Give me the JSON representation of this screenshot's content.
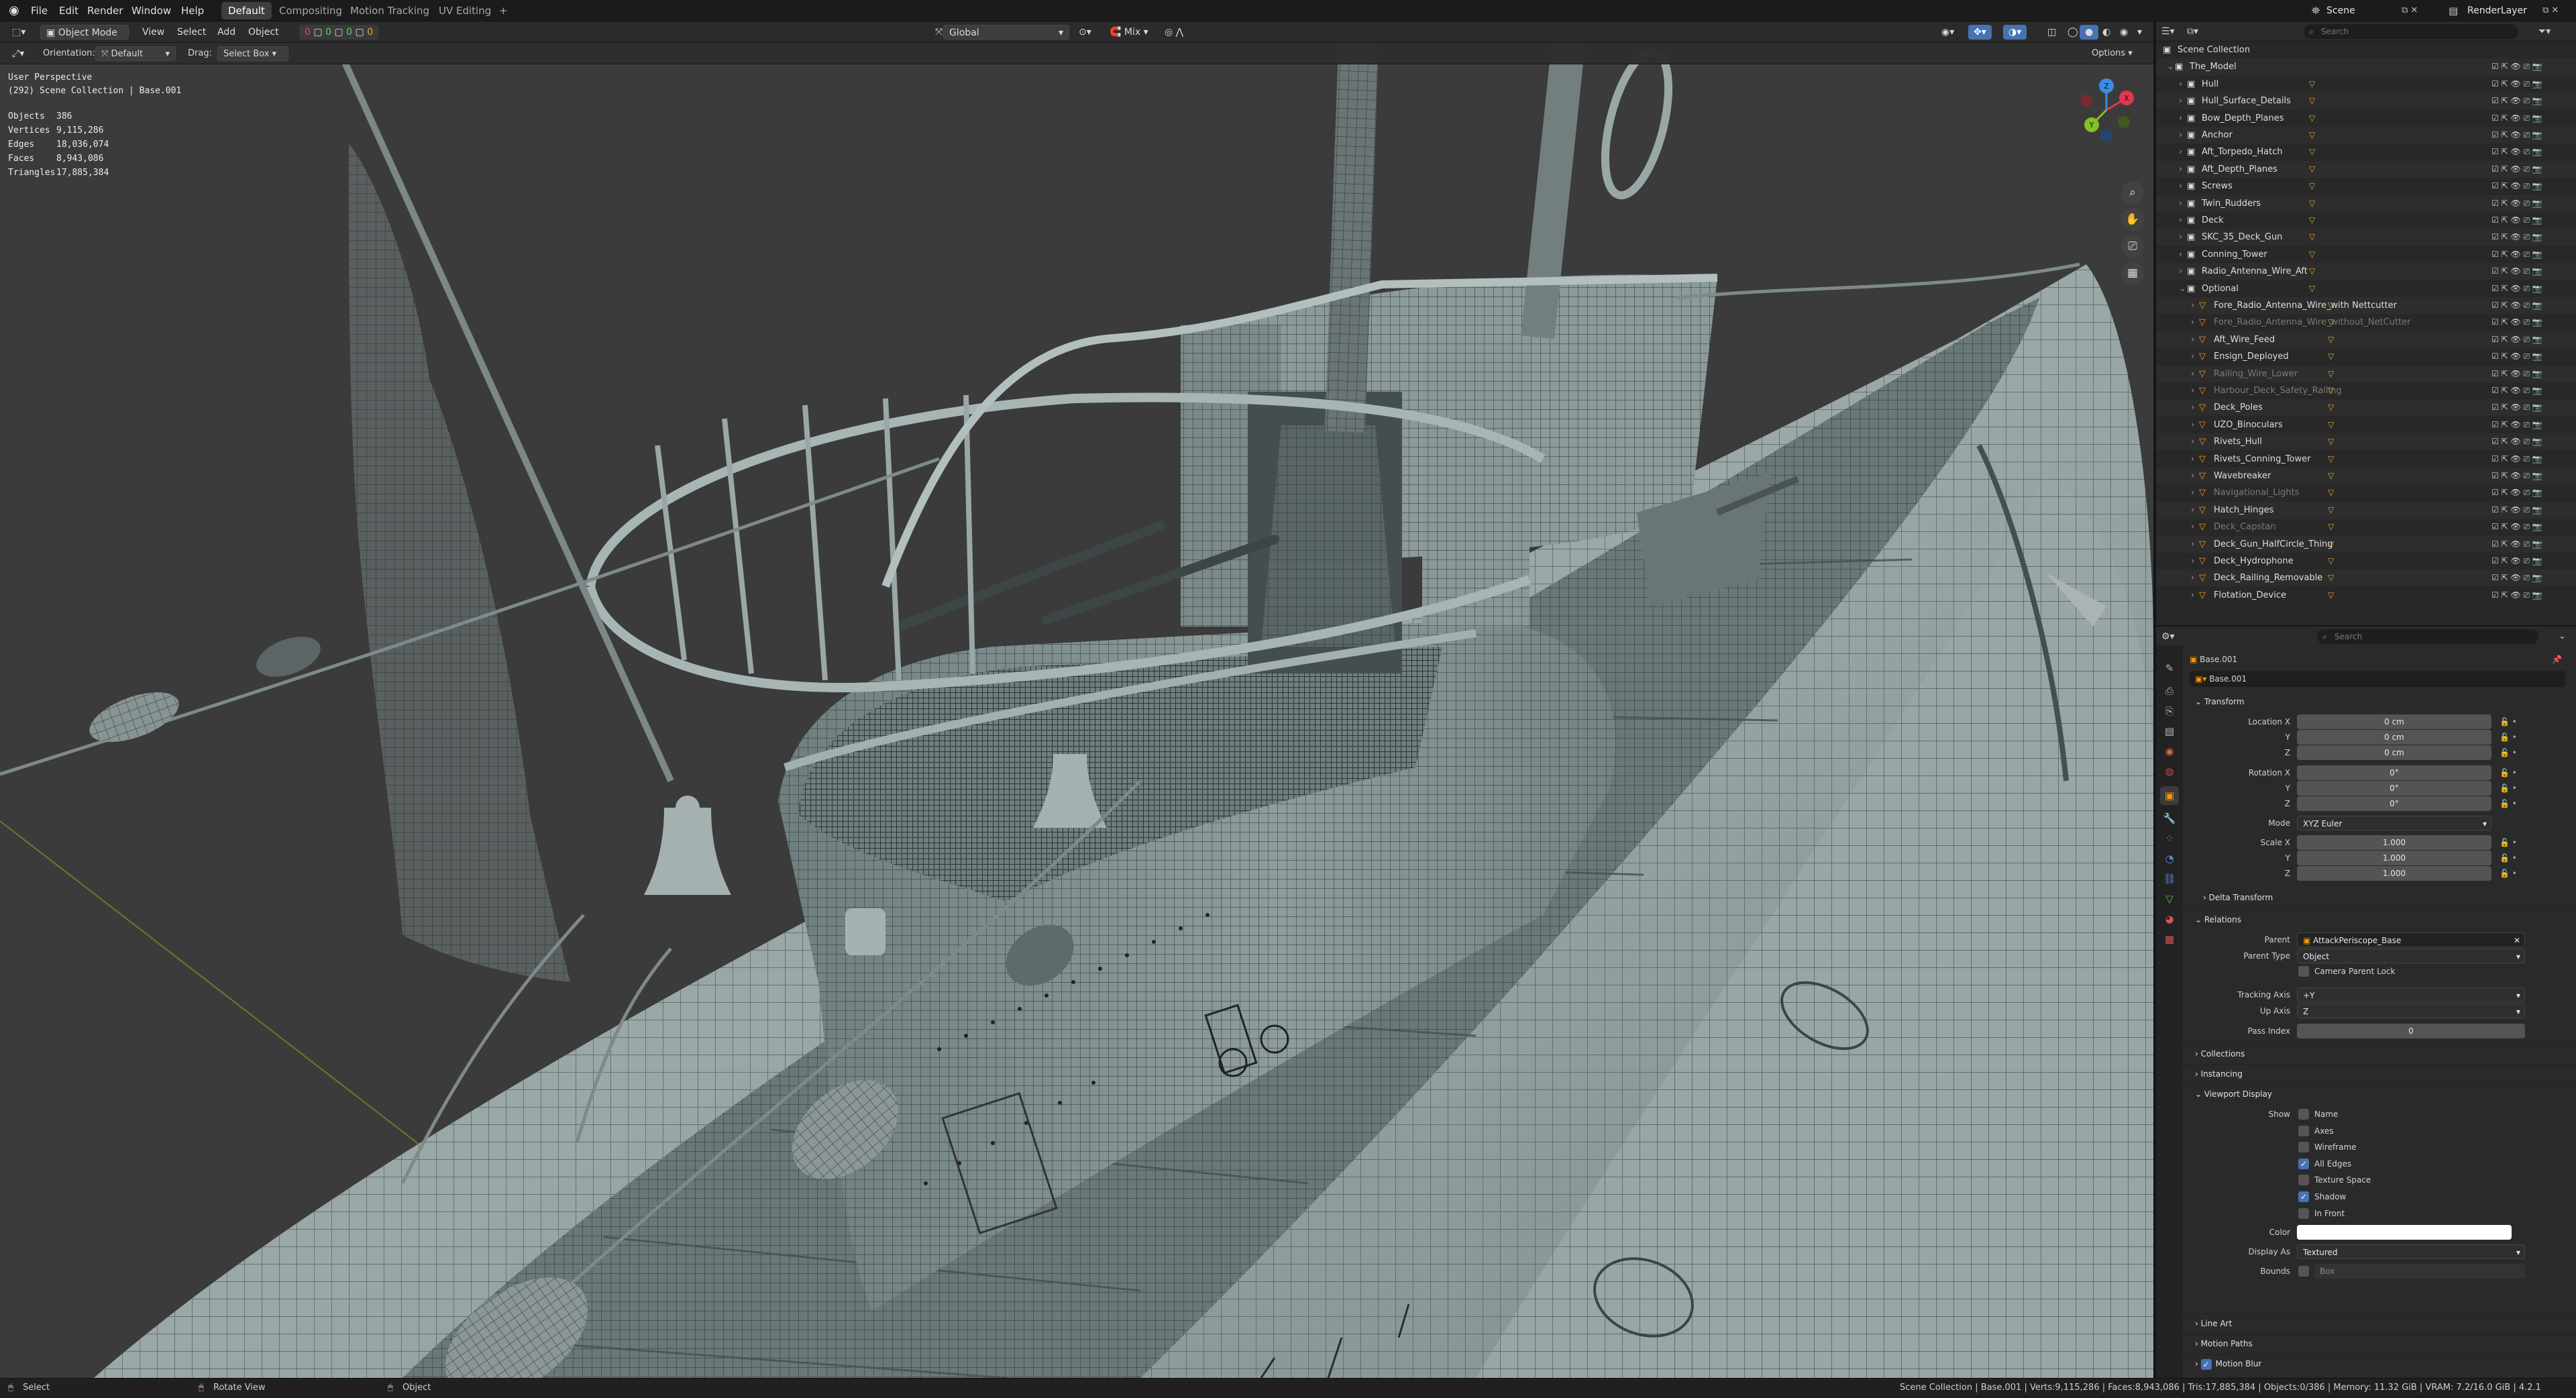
{
  "menubar": {
    "menus": [
      "File",
      "Edit",
      "Render",
      "Window",
      "Help"
    ],
    "workspaces": [
      "Default",
      "Compositing",
      "Motion Tracking",
      "UV Editing"
    ],
    "active_workspace": "Default",
    "add_tab": "+",
    "scene": "Scene",
    "render_layer": "RenderLayer"
  },
  "viewport_header": {
    "mode": "Object Mode",
    "menus": [
      "View",
      "Select",
      "Add",
      "Object"
    ],
    "transform_orientation": "Global",
    "pivot_label": "Mix",
    "orientation_label": "Orientation:",
    "orientation_value": "Default",
    "drag_label": "Drag:",
    "drag_value": "Select Box",
    "options": "Options",
    "visibility_counts": [
      "0",
      "0",
      "0",
      "0"
    ]
  },
  "overlay": {
    "view_name": "User Perspective",
    "collection_path": "(292) Scene Collection | Base.001",
    "stats": [
      {
        "label": "Objects",
        "value": "386"
      },
      {
        "label": "Vertices",
        "value": "9,115,286"
      },
      {
        "label": "Edges",
        "value": "18,036,074"
      },
      {
        "label": "Faces",
        "value": "8,943,086"
      },
      {
        "label": "Triangles",
        "value": "17,885,384"
      }
    ],
    "axes": {
      "x": "X",
      "y": "Y",
      "z": "Z"
    },
    "colors": {
      "x": "#e4374e",
      "y": "#83c225",
      "z": "#3b8de3"
    }
  },
  "outliner": {
    "search_placeholder": "Search",
    "root": "Scene Collection",
    "collection": "The_Model",
    "items": [
      {
        "label": "Hull",
        "depth": 1,
        "dim": false
      },
      {
        "label": "Hull_Surface_Details",
        "depth": 1,
        "dim": false
      },
      {
        "label": "Bow_Depth_Planes",
        "depth": 1,
        "dim": false
      },
      {
        "label": "Anchor",
        "depth": 1,
        "dim": false
      },
      {
        "label": "Aft_Torpedo_Hatch",
        "depth": 1,
        "dim": false
      },
      {
        "label": "Aft_Depth_Planes",
        "depth": 1,
        "dim": false
      },
      {
        "label": "Screws",
        "depth": 1,
        "dim": false
      },
      {
        "label": "Twin_Rudders",
        "depth": 1,
        "dim": false
      },
      {
        "label": "Deck",
        "depth": 1,
        "dim": false
      },
      {
        "label": "SKC_35_Deck_Gun",
        "depth": 1,
        "dim": false
      },
      {
        "label": "Conning_Tower",
        "depth": 1,
        "dim": false
      },
      {
        "label": "Radio_Antenna_Wire_Aft",
        "depth": 1,
        "dim": false
      },
      {
        "label": "Optional",
        "depth": 1,
        "dim": false
      },
      {
        "label": "Fore_Radio_Antenna_Wire_with Nettcutter",
        "depth": 2,
        "dim": false
      },
      {
        "label": "Fore_Radio_Antenna_Wire_without_NetCutter",
        "depth": 2,
        "dim": true
      },
      {
        "label": "Aft_Wire_Feed",
        "depth": 2,
        "dim": false
      },
      {
        "label": "Ensign_Deployed",
        "depth": 2,
        "dim": false
      },
      {
        "label": "Railing_Wire_Lower",
        "depth": 2,
        "dim": true
      },
      {
        "label": "Harbour_Deck_Safety_Railing",
        "depth": 2,
        "dim": true
      },
      {
        "label": "Deck_Poles",
        "depth": 2,
        "dim": false
      },
      {
        "label": "UZO_Binoculars",
        "depth": 2,
        "dim": false
      },
      {
        "label": "Rivets_Hull",
        "depth": 2,
        "dim": false
      },
      {
        "label": "Rivets_Conning_Tower",
        "depth": 2,
        "dim": false
      },
      {
        "label": "Wavebreaker",
        "depth": 2,
        "dim": false
      },
      {
        "label": "Navigational_Lights",
        "depth": 2,
        "dim": true
      },
      {
        "label": "Hatch_Hinges",
        "depth": 2,
        "dim": false
      },
      {
        "label": "Deck_Capstan",
        "depth": 2,
        "dim": true
      },
      {
        "label": "Deck_Gun_HalfCircle_Thing",
        "depth": 2,
        "dim": false
      },
      {
        "label": "Deck_Hydrophone",
        "depth": 2,
        "dim": false
      },
      {
        "label": "Deck_Railing_Removable",
        "depth": 2,
        "dim": false
      },
      {
        "label": "Flotation_Device",
        "depth": 2,
        "dim": false
      }
    ]
  },
  "properties": {
    "search_placeholder": "Search",
    "object_name": "Base.001",
    "object_field": "Base.001",
    "transform": {
      "title": "Transform",
      "location_label": "Location X",
      "location": [
        "0 cm",
        "0 cm",
        "0 cm"
      ],
      "rotation_label": "Rotation X",
      "rotation": [
        "0°",
        "0°",
        "0°"
      ],
      "mode_label": "Mode",
      "mode": "XYZ Euler",
      "scale_label": "Scale X",
      "scale": [
        "1.000",
        "1.000",
        "1.000"
      ],
      "axis_y": "Y",
      "axis_z": "Z"
    },
    "delta_transform": "Delta Transform",
    "relations": {
      "title": "Relations",
      "parent_label": "Parent",
      "parent": "AttackPeriscope_Base",
      "parent_type_label": "Parent Type",
      "parent_type": "Object",
      "camera_parent_lock": "Camera Parent Lock",
      "tracking_axis_label": "Tracking Axis",
      "tracking_axis": "+Y",
      "up_axis_label": "Up Axis",
      "up_axis": "Z",
      "pass_index_label": "Pass Index",
      "pass_index": "0"
    },
    "collections": "Collections",
    "instancing": "Instancing",
    "viewport_display": {
      "title": "Viewport Display",
      "show_label": "Show",
      "options": [
        {
          "label": "Name",
          "checked": false
        },
        {
          "label": "Axes",
          "checked": false
        },
        {
          "label": "Wireframe",
          "checked": false
        },
        {
          "label": "All Edges",
          "checked": true
        },
        {
          "label": "Texture Space",
          "checked": false
        },
        {
          "label": "Shadow",
          "checked": true
        },
        {
          "label": "In Front",
          "checked": false
        }
      ],
      "color_label": "Color",
      "display_as_label": "Display As",
      "display_as": "Textured",
      "bounds_label": "Bounds",
      "bounds": "Box"
    },
    "line_art": "Line Art",
    "motion_paths": "Motion Paths",
    "motion_blur": "Motion Blur"
  },
  "statusbar": {
    "left": [
      {
        "icon": "mouse-left-icon",
        "label": "Select"
      },
      {
        "icon": "mouse-middle-icon",
        "label": "Rotate View"
      },
      {
        "icon": "mouse-right-icon",
        "label": "Object"
      }
    ],
    "right": "Scene Collection | Base.001 | Verts:9,115,286 | Faces:8,943,086 | Tris:17,885,384 | Objects:0/386 | Memory: 11.32 GiB | VRAM: 7.2/16.0 GiB | 4.2.1"
  }
}
